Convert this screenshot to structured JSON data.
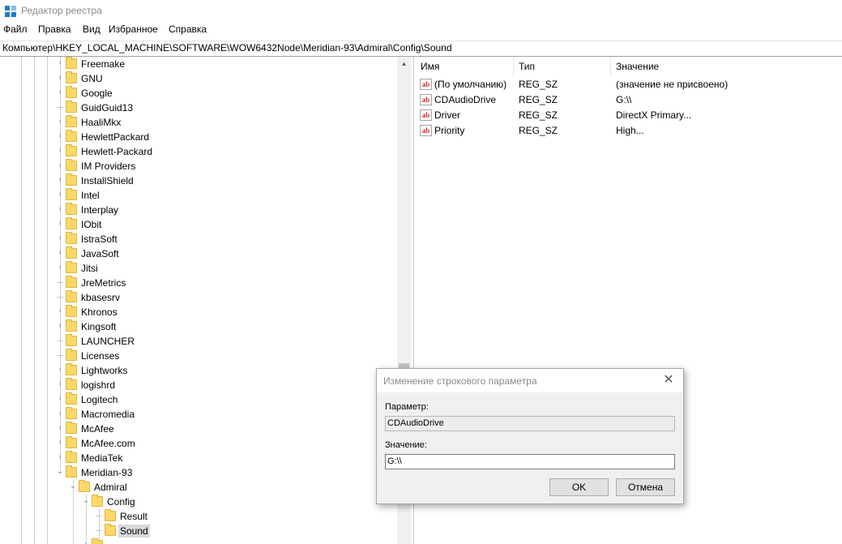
{
  "window": {
    "title": "Редактор реестра"
  },
  "menu": [
    "Файл",
    "Правка",
    "Вид",
    "Избранное",
    "Справка"
  ],
  "address": {
    "path": "Компьютер\\HKEY_LOCAL_MACHINE\\SOFTWARE\\WOW6432Node\\Meridian-93\\Admiral\\Config\\Sound"
  },
  "tree": {
    "items": [
      {
        "label": "Freemake"
      },
      {
        "label": "GNU"
      },
      {
        "label": "Google"
      },
      {
        "label": "GuidGuid13"
      },
      {
        "label": "HaaliMkx"
      },
      {
        "label": "HewlettPackard"
      },
      {
        "label": "Hewlett-Packard"
      },
      {
        "label": "IM Providers"
      },
      {
        "label": "InstallShield"
      },
      {
        "label": "Intel"
      },
      {
        "label": "Interplay"
      },
      {
        "label": "IObit"
      },
      {
        "label": "IstraSoft"
      },
      {
        "label": "JavaSoft"
      },
      {
        "label": "Jitsi"
      },
      {
        "label": "JreMetrics"
      },
      {
        "label": "kbasesrv"
      },
      {
        "label": "Khronos"
      },
      {
        "label": "Kingsoft"
      },
      {
        "label": "LAUNCHER"
      },
      {
        "label": "Licenses"
      },
      {
        "label": "Lightworks"
      },
      {
        "label": "logishrd"
      },
      {
        "label": "Logitech"
      },
      {
        "label": "Macromedia"
      },
      {
        "label": "McAfee"
      },
      {
        "label": "McAfee.com"
      },
      {
        "label": "MediaTek"
      },
      {
        "label": "Meridian-93"
      },
      {
        "label": "Admiral"
      },
      {
        "label": "Config"
      },
      {
        "label": "Result"
      },
      {
        "label": "Sound"
      }
    ]
  },
  "list": {
    "columns": [
      "Имя",
      "Тип",
      "Значение"
    ],
    "rows": [
      {
        "name": "(По умолчанию)",
        "type": "REG_SZ",
        "value": "(значение не присвоено)"
      },
      {
        "name": "CDAudioDrive",
        "type": "REG_SZ",
        "value": "G:\\\\"
      },
      {
        "name": "Driver",
        "type": "REG_SZ",
        "value": "DirectX Primary..."
      },
      {
        "name": "Priority",
        "type": "REG_SZ",
        "value": "High..."
      }
    ],
    "icon_text": "ab"
  },
  "dialog": {
    "title": "Изменение строкового параметра",
    "param_label": "Параметр:",
    "param_value": "CDAudioDrive",
    "value_label": "Значение:",
    "value_value": "G:\\\\",
    "ok_label": "OK",
    "cancel_label": "Отмена"
  }
}
